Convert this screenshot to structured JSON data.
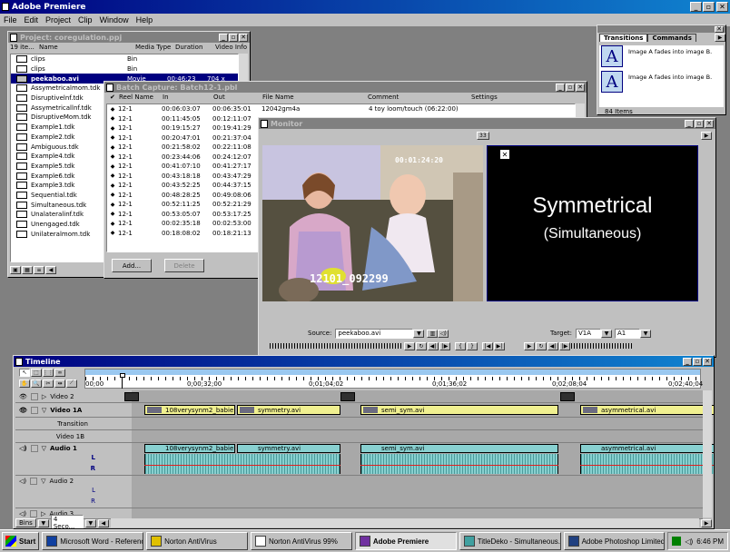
{
  "app": {
    "title": "Adobe Premiere"
  },
  "menu": [
    "File",
    "Edit",
    "Project",
    "Clip",
    "Window",
    "Help"
  ],
  "project": {
    "title": "Project: coregulation.ppj",
    "count": "19 ite...",
    "columns": [
      "Name",
      "Media Type",
      "Duration",
      "Video Info"
    ],
    "items": [
      {
        "name": "clips",
        "type": "Bin",
        "dur": "",
        "info": ""
      },
      {
        "name": "clips",
        "type": "Bin",
        "dur": "",
        "info": ""
      },
      {
        "name": "peekaboo.avi",
        "type": "Movie",
        "dur": "00;46;23",
        "info": "704 x"
      },
      {
        "name": "Assymetricalmom.tdk",
        "type": "",
        "dur": "",
        "info": ""
      },
      {
        "name": "Disruptivelnf.tdk",
        "type": "",
        "dur": "",
        "info": ""
      },
      {
        "name": "Assymetricallnf.tdk",
        "type": "",
        "dur": "",
        "info": ""
      },
      {
        "name": "DisruptiveMom.tdk",
        "type": "",
        "dur": "",
        "info": ""
      },
      {
        "name": "Example1.tdk",
        "type": "",
        "dur": "",
        "info": ""
      },
      {
        "name": "Example2.tdk",
        "type": "",
        "dur": "",
        "info": ""
      },
      {
        "name": "Ambiguous.tdk",
        "type": "",
        "dur": "",
        "info": ""
      },
      {
        "name": "Example4.tdk",
        "type": "",
        "dur": "",
        "info": ""
      },
      {
        "name": "Example5.tdk",
        "type": "",
        "dur": "",
        "info": ""
      },
      {
        "name": "Example6.tdk",
        "type": "",
        "dur": "",
        "info": ""
      },
      {
        "name": "Example3.tdk",
        "type": "",
        "dur": "",
        "info": ""
      },
      {
        "name": "Sequential.tdk",
        "type": "",
        "dur": "",
        "info": ""
      },
      {
        "name": "Simultaneous.tdk",
        "type": "",
        "dur": "",
        "info": ""
      },
      {
        "name": "Unalateralinf.tdk",
        "type": "",
        "dur": "",
        "info": ""
      },
      {
        "name": "Unengaged.tdk",
        "type": "",
        "dur": "",
        "info": ""
      },
      {
        "name": "Unilateralmom.tdk",
        "type": "",
        "dur": "",
        "info": ""
      }
    ]
  },
  "batch": {
    "title": "Batch Capture: Batch12-1.pbl",
    "columns": [
      "✔",
      "Reel Name",
      "In",
      "Out",
      "File Name",
      "Comment",
      "Settings"
    ],
    "rows": [
      {
        "reel": "12-1",
        "in": "00:06:03:07",
        "out": "00:06:35:01",
        "file": "12042gm4a",
        "comment": "4 toy loom/touch (06:22:00)"
      },
      {
        "reel": "12-1",
        "in": "00:11:45:05",
        "out": "00:12:11:07",
        "file": "",
        "comment": ""
      },
      {
        "reel": "12-1",
        "in": "00:19:15:27",
        "out": "00:19:41:29",
        "file": "",
        "comment": ""
      },
      {
        "reel": "12-1",
        "in": "00:20:47:01",
        "out": "00:21:37:04",
        "file": "",
        "comment": ""
      },
      {
        "reel": "12-1",
        "in": "00:21:58:02",
        "out": "00:22:11:08",
        "file": "",
        "comment": ""
      },
      {
        "reel": "12-1",
        "in": "00:23:44:06",
        "out": "00:24:12:07",
        "file": "",
        "comment": ""
      },
      {
        "reel": "12-1",
        "in": "00:41:07:10",
        "out": "00:41:27:17",
        "file": "",
        "comment": ""
      },
      {
        "reel": "12-1",
        "in": "00:43:18:18",
        "out": "00:43:47:29",
        "file": "",
        "comment": ""
      },
      {
        "reel": "12-1",
        "in": "00:43:52:25",
        "out": "00:44:37:15",
        "file": "",
        "comment": ""
      },
      {
        "reel": "12-1",
        "in": "00:48:28:25",
        "out": "00:49:08:06",
        "file": "",
        "comment": ""
      },
      {
        "reel": "12-1",
        "in": "00:52:11:25",
        "out": "00:52:21:29",
        "file": "",
        "comment": ""
      },
      {
        "reel": "12-1",
        "in": "00:53:05:07",
        "out": "00:53:17:25",
        "file": "",
        "comment": ""
      },
      {
        "reel": "12-1",
        "in": "00:02:35:18",
        "out": "00:02:53:00",
        "file": "",
        "comment": ""
      },
      {
        "reel": "12-1",
        "in": "00:18:08:02",
        "out": "00:18:21:13",
        "file": "",
        "comment": ""
      }
    ],
    "add_label": "Add...",
    "delete_label": "Delete"
  },
  "monitor": {
    "title": "Monitor",
    "source_timecode": "00:01:24:20",
    "source_caption": "12101_092299",
    "target_title": "Symmetrical",
    "target_subtitle": "(Simultaneous)",
    "source_label": "Source:",
    "source_value": "peekaboo.avi",
    "target_label": "Target:",
    "target_v": "V1A",
    "target_a": "A1",
    "pp_badge": "33"
  },
  "transitions": {
    "tabs": [
      "Transitions",
      "Commands"
    ],
    "items": [
      {
        "glyph": "A",
        "desc": "Image A fades into image B."
      },
      {
        "glyph": "A",
        "desc": "Image A fades into image B."
      }
    ],
    "count": "84 Items"
  },
  "timeline": {
    "title": "Timeline",
    "ruler": [
      "00;00",
      "0;00;32;00",
      "0;01;04;02",
      "0;01;36;02",
      "0;02;08;04",
      "0;02;40;04"
    ],
    "tracks": {
      "video2": "Video 2",
      "video1a": "Video 1A",
      "transition": "Transition",
      "video1b": "Video 1B",
      "audio1": "Audio 1",
      "audio2": "Audio 2",
      "audio3": "Audio 3"
    },
    "video_clips": [
      "108verysynm2_babie...",
      "symmetry.avi",
      "semi_sym.avi",
      "asymmetrical.avi"
    ],
    "audio_clips": [
      "108verysynm2_babie...",
      "symmetry.avi",
      "semi_sym.avi",
      "asymmetrical.avi"
    ],
    "lr": [
      "L",
      "R"
    ],
    "footer_bins": "Bins",
    "footer_zoom": "4 Seco..."
  },
  "taskbar": {
    "start": "Start",
    "tasks": [
      "Microsoft Word - Referenc...",
      "Norton AntiVirus",
      "Norton AntiVirus 99%",
      "Adobe Premiere",
      "TitleDeko - Simultaneous.tdk",
      "Adobe Photoshop Limited ..."
    ],
    "clock": "6:46 PM"
  }
}
